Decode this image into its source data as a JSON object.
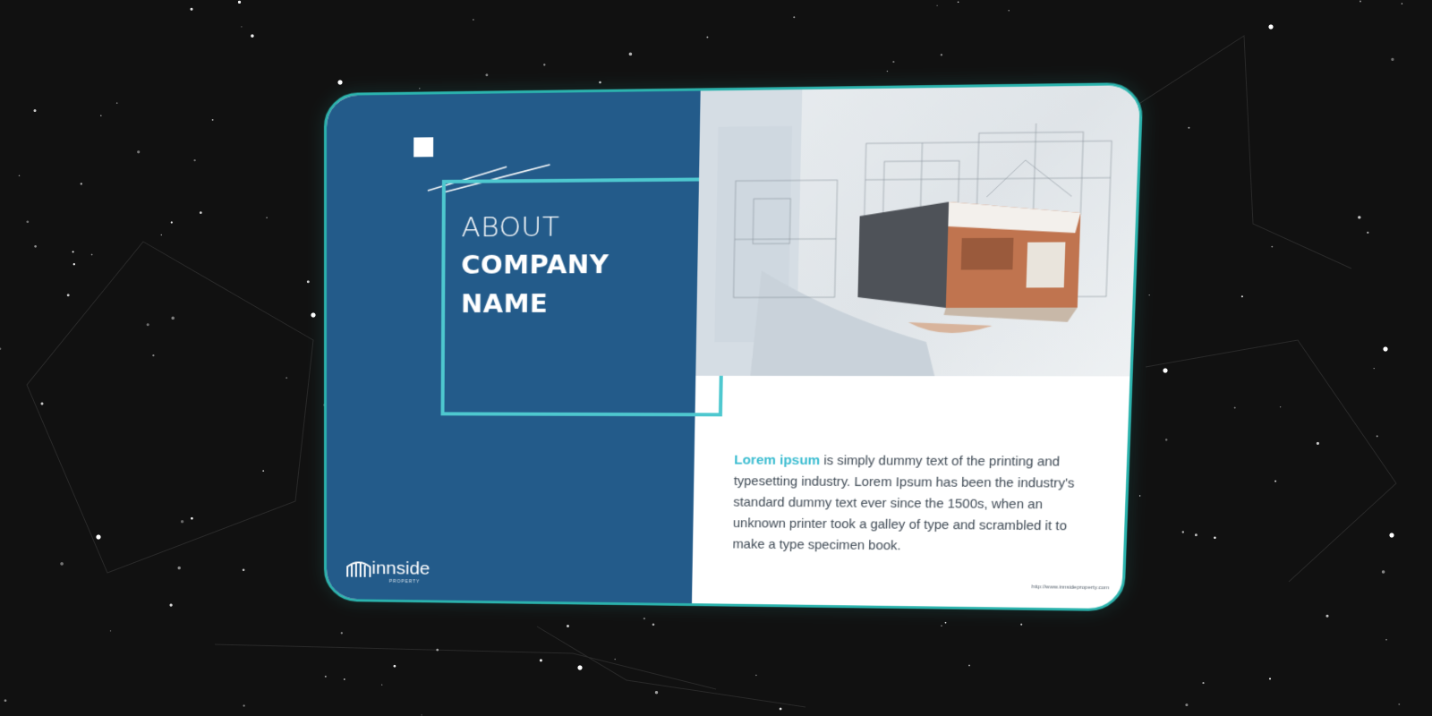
{
  "card": {
    "title_line1": "ABOUT",
    "title_line2": "COMPANY",
    "title_line3": "NAME",
    "body_highlight": "Lorem ipsum",
    "body_text": " is simply dummy text of the printing and typesetting industry. Lorem Ipsum has been the industry's standard dummy text ever since the 1500s, when an unknown printer took a galley of type and scrambled it to make a type specimen book.",
    "logo_text": "innside",
    "logo_subtext": "PROPERTY",
    "url": "http://www.innsideproperty.com"
  },
  "colors": {
    "background": "#111111",
    "panel_blue": "#235b8a",
    "accent_teal": "#4ec8cf",
    "highlight_cyan": "#39bcd0",
    "card_border": "#2bb3ad"
  },
  "icons": [
    "logo-house-icon",
    "white-square-icon",
    "architecture-model-image"
  ]
}
